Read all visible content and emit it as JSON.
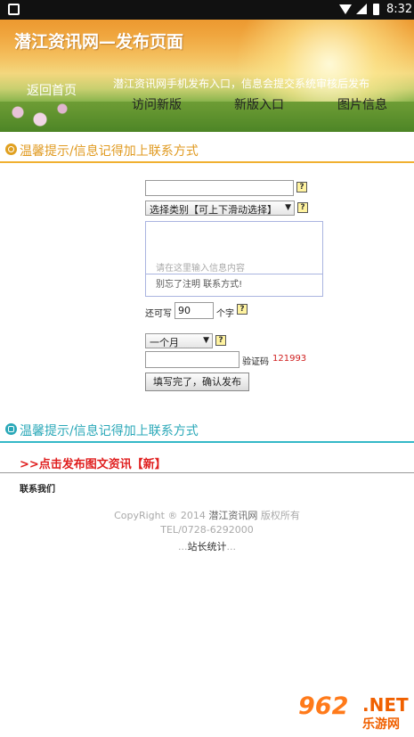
{
  "status_bar": {
    "time": "8:32",
    "icons": [
      "app-square-icon",
      "wifi-icon",
      "signal-icon",
      "battery-icon"
    ]
  },
  "header": {
    "title": "潜江资讯网—发布页面",
    "back_link": "返回首页",
    "notice": "潜江资讯网手机发布入口，信息会提交系统审核后发布",
    "nav": [
      "访问新版",
      "新版入口",
      "图片信息"
    ]
  },
  "tips": {
    "top": "温馨提示/信息记得加上联系方式",
    "bottom": "温馨提示/信息记得加上联系方式"
  },
  "form": {
    "title_value": "",
    "help_symbol": "?",
    "category_selected": "选择类别【可上下滑动选择】",
    "content_placeholder": "请在这里输入信息内容",
    "content_hint": "别忘了注明 联系方式!",
    "remaining_label": "还可写",
    "remaining_value": "90",
    "remaining_unit": "个字",
    "duration_selected": "一个月",
    "captcha_label": "验证码",
    "captcha_code": "121993",
    "submit_label": "填写完了，确认发布"
  },
  "links": {
    "publish_image_news": ">>点击发布图文资讯【新】",
    "contact_us": "联系我们"
  },
  "footer": {
    "copyright_prefix": "CopyRight ® 2014",
    "copyright_site": "潜江资讯网",
    "copyright_suffix": "版权所有",
    "tel": "TEL/0728-6292000",
    "stats_dots_left": "...",
    "stats": "站长统计",
    "stats_dots_right": "..."
  },
  "watermark": {
    "logo": "962",
    "net": ".NET",
    "sub": "乐游网"
  },
  "colors": {
    "tip_top": "#e09a20",
    "tip_bottom": "#2aa8b8",
    "link_red": "#e02020",
    "captcha_red": "#d02020"
  }
}
